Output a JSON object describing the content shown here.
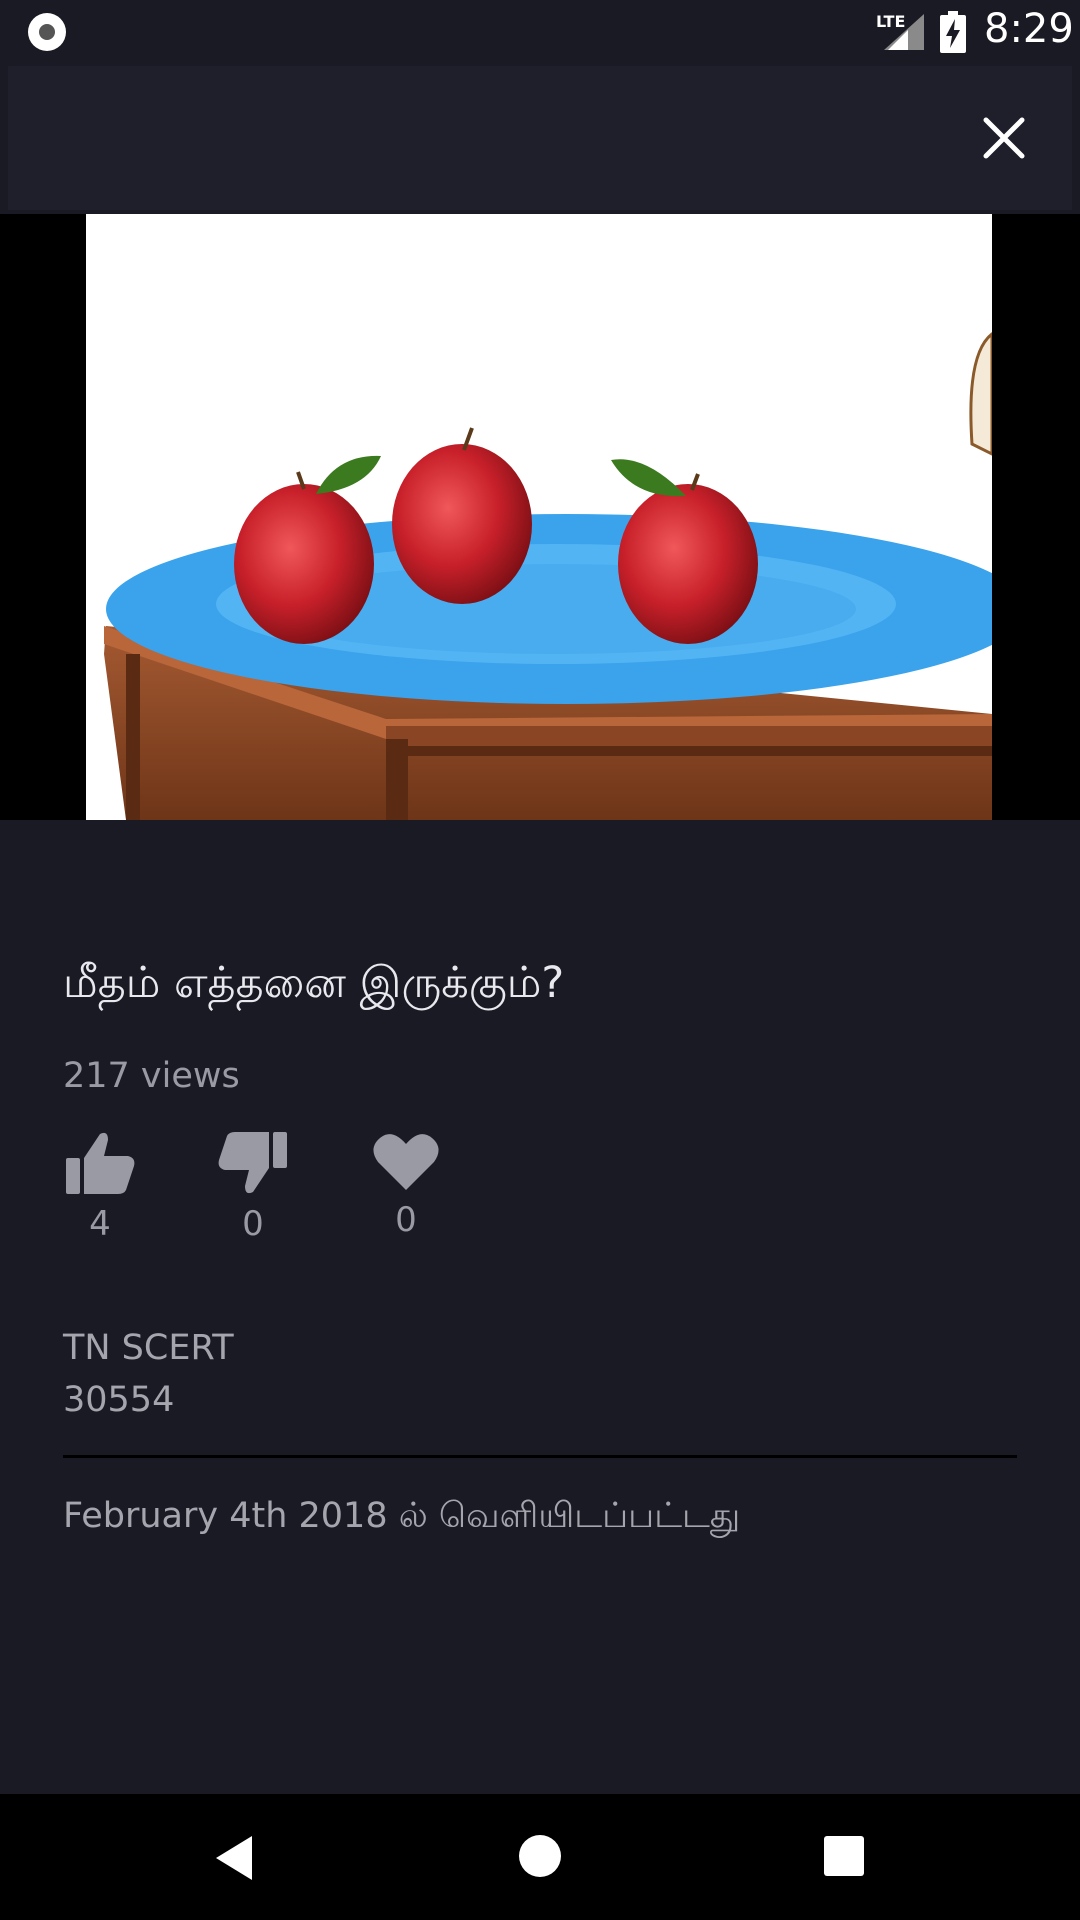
{
  "status_bar": {
    "time": "8:29",
    "network": "LTE",
    "icons": [
      "record-icon",
      "signal-icon",
      "battery-charging-icon"
    ]
  },
  "toolbar": {
    "close_icon": "close-icon"
  },
  "video": {
    "thumbnail_description_icon": "video-thumbnail"
  },
  "details": {
    "title": "மீதம் எத்தனை இருக்கும்?",
    "views": "217 views",
    "likes": "4",
    "dislikes": "0",
    "favorites": "0",
    "channel_name": "TN SCERT",
    "channel_number": "30554",
    "published": "February 4th 2018 ல் வெளியிடப்பட்டது"
  },
  "colors": {
    "background": "#1a1a24",
    "toolbar": "#1f1f2c",
    "text_primary": "#e8e8ee",
    "text_secondary": "#9a9aa4",
    "plate": "#3aa3ec",
    "apple": "#c8202a"
  },
  "nav_bar": {
    "icons": [
      "back-icon",
      "home-icon",
      "recents-icon"
    ]
  }
}
